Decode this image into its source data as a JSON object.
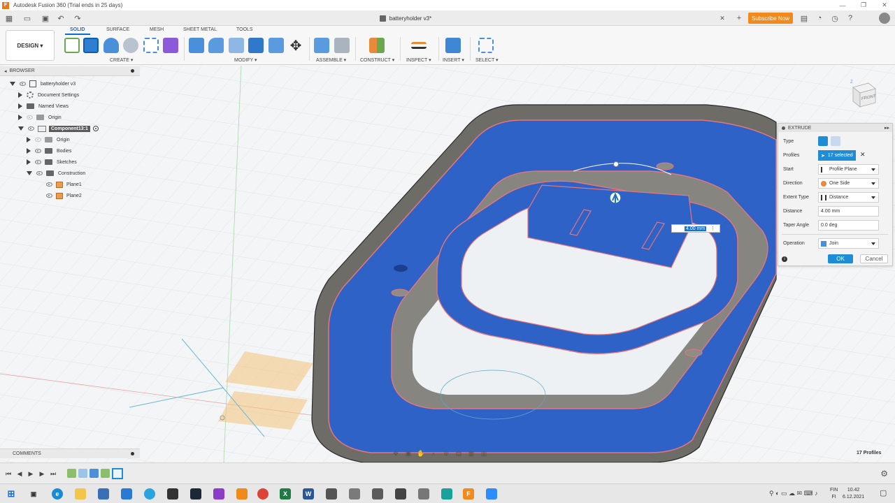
{
  "window": {
    "title": "Autodesk Fusion 360 (Trial ends in 25 days)"
  },
  "document_tab": {
    "label": "batteryholder v3*"
  },
  "header": {
    "subscribe_label": "Subscribe Now"
  },
  "workspace": {
    "label": "DESIGN ▾"
  },
  "ribbon": {
    "tabs": [
      "SOLID",
      "SURFACE",
      "MESH",
      "SHEET METAL",
      "TOOLS"
    ],
    "groups": [
      "CREATE ▾",
      "MODIFY ▾",
      "ASSEMBLE ▾",
      "CONSTRUCT ▾",
      "INSPECT ▾",
      "INSERT ▾",
      "SELECT ▾"
    ]
  },
  "browser": {
    "title": "BROWSER",
    "items": [
      {
        "label": "batteryholder v3"
      },
      {
        "label": "Document Settings"
      },
      {
        "label": "Named Views"
      },
      {
        "label": "Origin"
      },
      {
        "label": "Component13:1"
      },
      {
        "label": "Origin"
      },
      {
        "label": "Bodies"
      },
      {
        "label": "Sketches"
      },
      {
        "label": "Construction"
      },
      {
        "label": "Plane1"
      },
      {
        "label": "Plane2"
      }
    ]
  },
  "extrude": {
    "title": "EXTRUDE",
    "labels": {
      "type": "Type",
      "profiles": "Profiles",
      "start": "Start",
      "direction": "Direction",
      "extent_type": "Extent Type",
      "distance": "Distance",
      "taper_angle": "Taper Angle",
      "operation": "Operation"
    },
    "values": {
      "profiles": "17 selected",
      "start": "Profile Plane",
      "direction": "One Side",
      "extent_type": "Distance",
      "distance": "4.00 mm",
      "taper_angle": "0.0 deg",
      "operation": "Join"
    },
    "ok_label": "OK",
    "cancel_label": "Cancel"
  },
  "viewport": {
    "distance_input": "4.00 mm",
    "viewcube_label": "FRONT",
    "profiles_count": "17 Profiles"
  },
  "comments": {
    "title": "COMMENTS"
  },
  "taskbar": {
    "time": "10.42",
    "date": "6.12.2021",
    "lang_top": "FIN",
    "lang_bottom": "FI"
  },
  "colors": {
    "accent": "#1f8dd6",
    "selected_face": "#2f62c6",
    "body_gray": "#6e6c66",
    "subscribe": "#f08a1c",
    "profile_outline": "#e8757a"
  }
}
